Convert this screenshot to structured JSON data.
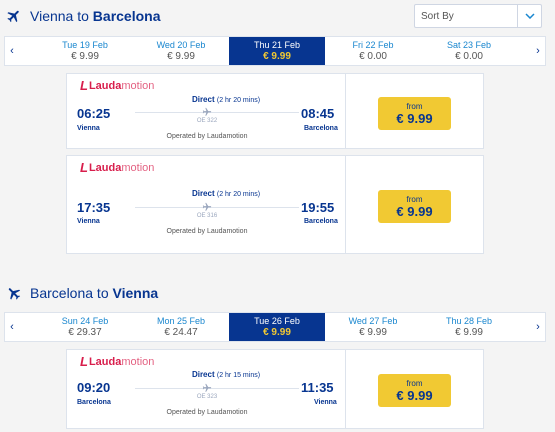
{
  "sort": {
    "label": "Sort By"
  },
  "outbound": {
    "title_pre": "Vienna to ",
    "title_dest": "Barcelona",
    "dates": [
      {
        "day": "Tue 19 Feb",
        "price": "€ 9.99",
        "selected": false
      },
      {
        "day": "Wed 20 Feb",
        "price": "€ 9.99",
        "selected": false
      },
      {
        "day": "Thu 21 Feb",
        "price": "€ 9.99",
        "selected": true
      },
      {
        "day": "Fri 22 Feb",
        "price": "€ 0.00",
        "selected": false
      },
      {
        "day": "Sat 23 Feb",
        "price": "€ 0.00",
        "selected": false
      }
    ],
    "flights": [
      {
        "airline_a": "Lauda",
        "airline_b": "motion",
        "depart": "06:25",
        "arrive": "08:45",
        "from_city": "Vienna",
        "to_city": "Barcelona",
        "type": "Direct",
        "duration": "(2 hr 20 mins)",
        "flight_no": "OE 322",
        "operated": "Operated by Laudamotion",
        "from_label": "from",
        "price": "€ 9.99"
      },
      {
        "airline_a": "Lauda",
        "airline_b": "motion",
        "depart": "17:35",
        "arrive": "19:55",
        "from_city": "Vienna",
        "to_city": "Barcelona",
        "type": "Direct",
        "duration": "(2 hr 20 mins)",
        "flight_no": "OE 316",
        "operated": "Operated by Laudamotion",
        "from_label": "from",
        "price": "€ 9.99"
      }
    ]
  },
  "inbound": {
    "title_pre": "Barcelona to ",
    "title_dest": "Vienna",
    "dates": [
      {
        "day": "Sun 24 Feb",
        "price": "€ 29.37",
        "selected": false
      },
      {
        "day": "Mon 25 Feb",
        "price": "€ 24.47",
        "selected": false
      },
      {
        "day": "Tue 26 Feb",
        "price": "€ 9.99",
        "selected": true
      },
      {
        "day": "Wed 27 Feb",
        "price": "€ 9.99",
        "selected": false
      },
      {
        "day": "Thu 28 Feb",
        "price": "€ 9.99",
        "selected": false
      }
    ],
    "flights": [
      {
        "airline_a": "Lauda",
        "airline_b": "motion",
        "depart": "09:20",
        "arrive": "11:35",
        "from_city": "Barcelona",
        "to_city": "Vienna",
        "type": "Direct",
        "duration": "(2 hr 15 mins)",
        "flight_no": "OE 323",
        "operated": "Operated by Laudamotion",
        "from_label": "from",
        "price": "€ 9.99"
      }
    ]
  },
  "icons": {
    "plane": "plane-icon",
    "chevron_down": "chevron-down-icon",
    "prev": "chevron-left-icon",
    "next": "chevron-right-icon"
  },
  "colors": {
    "brand_blue": "#073590",
    "accent_yellow": "#f1c933",
    "link_blue": "#1a87cf",
    "airline_red": "#d81e4c"
  }
}
